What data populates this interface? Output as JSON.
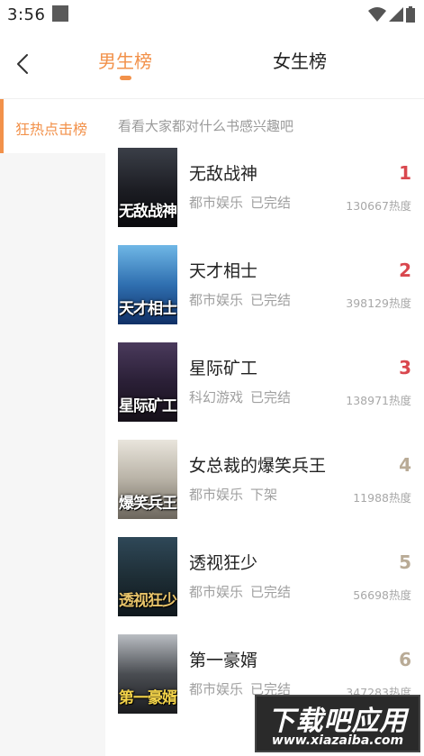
{
  "status_bar": {
    "time": "3:56"
  },
  "nav": {
    "tabs": [
      {
        "label": "男生榜",
        "active": true
      },
      {
        "label": "女生榜",
        "active": false
      }
    ]
  },
  "sidebar": {
    "items": [
      {
        "label": "狂热点击榜",
        "active": true
      }
    ]
  },
  "main": {
    "subtitle": "看看大家都对什么书感兴趣吧",
    "books": [
      {
        "rank": "1",
        "title": "无敌战神",
        "category": "都市娱乐",
        "status": "已完结",
        "heat": "130667热度",
        "cover_text": "无敌战神"
      },
      {
        "rank": "2",
        "title": "天才相士",
        "category": "都市娱乐",
        "status": "已完结",
        "heat": "398129热度",
        "cover_text": "天才相士"
      },
      {
        "rank": "3",
        "title": "星际矿工",
        "category": "科幻游戏",
        "status": "已完结",
        "heat": "138971热度",
        "cover_text": "星际矿工"
      },
      {
        "rank": "4",
        "title": "女总裁的爆笑兵王",
        "category": "都市娱乐",
        "status": "下架",
        "heat": "11988热度",
        "cover_text": "爆笑兵王"
      },
      {
        "rank": "5",
        "title": "透视狂少",
        "category": "都市娱乐",
        "status": "已完结",
        "heat": "56698热度",
        "cover_text": "透视狂少"
      },
      {
        "rank": "6",
        "title": "第一豪婿",
        "category": "都市娱乐",
        "status": "已完结",
        "heat": "347283热度",
        "cover_text": "第一豪婿"
      }
    ]
  },
  "watermark": {
    "title": "下载吧应用",
    "url": "www.xiazaiba.com"
  },
  "colors": {
    "accent": "#f2914a",
    "rank_top": "#d9474e",
    "rank_other": "#b9ab96"
  }
}
